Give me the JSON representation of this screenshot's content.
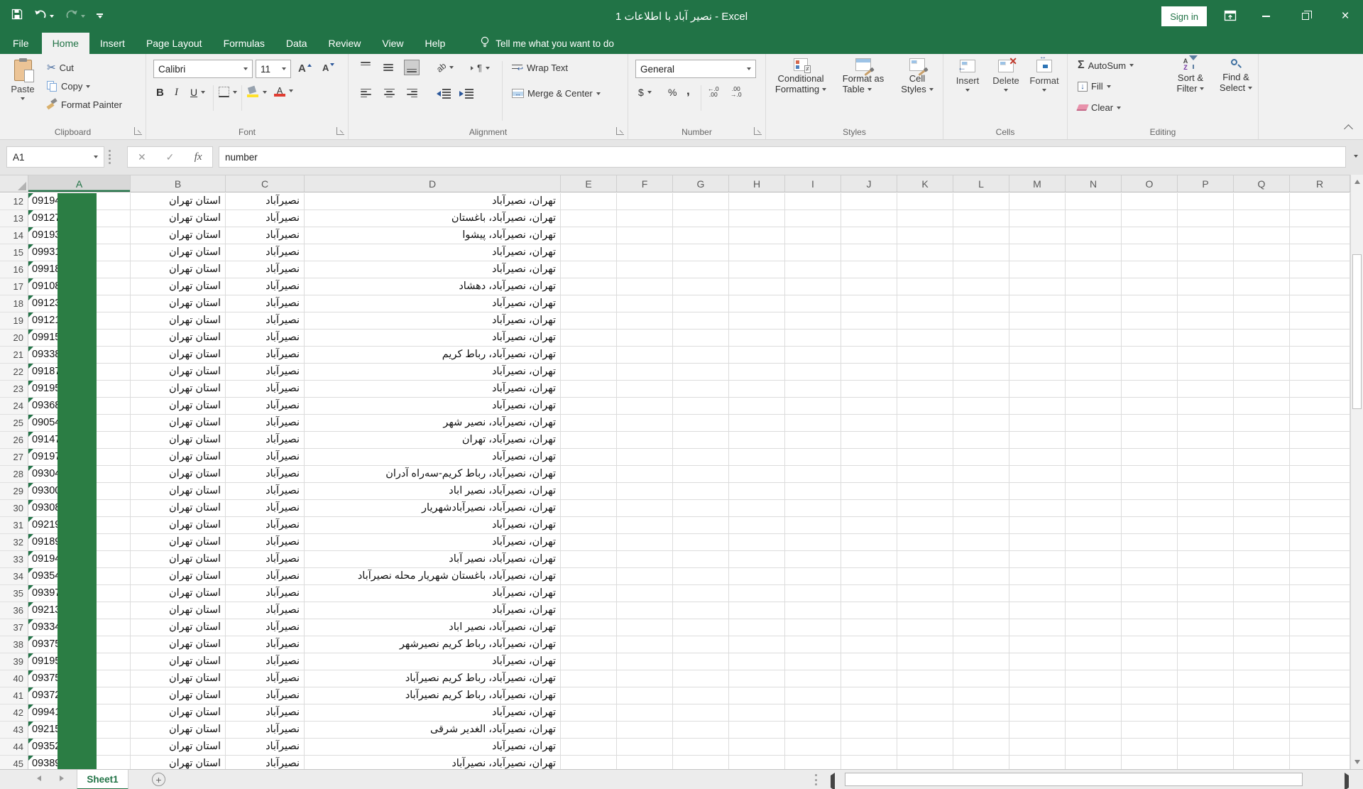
{
  "titlebar": {
    "title": "نصیر آباد با اطلاعات 1 - Excel",
    "sign_in": "Sign in"
  },
  "tabs": {
    "items": [
      "File",
      "Home",
      "Insert",
      "Page Layout",
      "Formulas",
      "Data",
      "Review",
      "View",
      "Help"
    ],
    "active": "Home",
    "tell_me": "Tell me what you want to do"
  },
  "ribbon": {
    "clipboard": {
      "label": "Clipboard",
      "paste": "Paste",
      "cut": "Cut",
      "copy": "Copy",
      "format_painter": "Format Painter"
    },
    "font": {
      "label": "Font",
      "family": "Calibri",
      "size": "11",
      "bold": "B",
      "italic": "I",
      "underline": "U"
    },
    "alignment": {
      "label": "Alignment",
      "wrap_text": "Wrap Text",
      "merge_center": "Merge & Center"
    },
    "number": {
      "label": "Number",
      "format": "General",
      "currency": "$",
      "percent": "%",
      "comma": ","
    },
    "styles": {
      "label": "Styles",
      "conditional_line1": "Conditional",
      "conditional_line2": "Formatting",
      "format_table_line1": "Format as",
      "format_table_line2": "Table",
      "cell_styles_line1": "Cell",
      "cell_styles_line2": "Styles"
    },
    "cells": {
      "label": "Cells",
      "insert": "Insert",
      "delete": "Delete",
      "format": "Format"
    },
    "editing": {
      "label": "Editing",
      "sigma": "Σ",
      "autosum": "AutoSum",
      "fill": "Fill",
      "clear": "Clear",
      "sort_line1": "Sort &",
      "sort_line2": "Filter",
      "find_line1": "Find &",
      "find_line2": "Select"
    }
  },
  "formula_bar": {
    "name_box": "A1",
    "fx": "fx",
    "value": "number"
  },
  "grid": {
    "selected_column": "A",
    "columns": [
      "A",
      "B",
      "C",
      "D",
      "E",
      "F",
      "G",
      "H",
      "I",
      "J",
      "K",
      "L",
      "M",
      "N",
      "O",
      "P",
      "Q",
      "R"
    ],
    "rows": [
      {
        "n": "12",
        "a": "09194",
        "b": "استان تهران",
        "c": "نصیرآباد",
        "d": "تهران، نصیرآباد"
      },
      {
        "n": "13",
        "a": "09127",
        "b": "استان تهران",
        "c": "نصیرآباد",
        "d": "تهران، نصیرآباد، باغستان"
      },
      {
        "n": "14",
        "a": "09193",
        "b": "استان تهران",
        "c": "نصیرآباد",
        "d": "تهران، نصیرآباد، پیشوا"
      },
      {
        "n": "15",
        "a": "09931",
        "b": "استان تهران",
        "c": "نصیرآباد",
        "d": "تهران، نصیرآباد"
      },
      {
        "n": "16",
        "a": "09918",
        "b": "استان تهران",
        "c": "نصیرآباد",
        "d": "تهران، نصیرآباد"
      },
      {
        "n": "17",
        "a": "09108",
        "b": "استان تهران",
        "c": "نصیرآباد",
        "d": "تهران، نصیرآباد، دهشاد"
      },
      {
        "n": "18",
        "a": "09123",
        "b": "استان تهران",
        "c": "نصیرآباد",
        "d": "تهران، نصیرآباد"
      },
      {
        "n": "19",
        "a": "09121",
        "b": "استان تهران",
        "c": "نصیرآباد",
        "d": "تهران، نصیرآباد"
      },
      {
        "n": "20",
        "a": "09915",
        "b": "استان تهران",
        "c": "نصیرآباد",
        "d": "تهران، نصیرآباد"
      },
      {
        "n": "21",
        "a": "09338",
        "b": "استان تهران",
        "c": "نصیرآباد",
        "d": "تهران، نصیرآباد، رباط کریم"
      },
      {
        "n": "22",
        "a": "09187",
        "b": "استان تهران",
        "c": "نصیرآباد",
        "d": "تهران، نصیرآباد"
      },
      {
        "n": "23",
        "a": "09195",
        "b": "استان تهران",
        "c": "نصیرآباد",
        "d": "تهران، نصیرآباد"
      },
      {
        "n": "24",
        "a": "09368",
        "b": "استان تهران",
        "c": "نصیرآباد",
        "d": "تهران، نصیرآباد"
      },
      {
        "n": "25",
        "a": "09054",
        "b": "استان تهران",
        "c": "نصیرآباد",
        "d": "تهران، نصیرآباد، نصیر شهر"
      },
      {
        "n": "26",
        "a": "09147",
        "b": "استان تهران",
        "c": "نصیرآباد",
        "d": "تهران، نصیرآباد، تهران"
      },
      {
        "n": "27",
        "a": "09197",
        "b": "استان تهران",
        "c": "نصیرآباد",
        "d": "تهران، نصیرآباد"
      },
      {
        "n": "28",
        "a": "09304",
        "b": "استان تهران",
        "c": "نصیرآباد",
        "d": "تهران، نصیرآباد، رباط کریم-سه‌راه آدران"
      },
      {
        "n": "29",
        "a": "09300",
        "b": "استان تهران",
        "c": "نصیرآباد",
        "d": "تهران، نصیرآباد، نصیر اباد"
      },
      {
        "n": "30",
        "a": "09308",
        "b": "استان تهران",
        "c": "نصیرآباد",
        "d": "تهران، نصیرآباد، نصیرآبادشهریار"
      },
      {
        "n": "31",
        "a": "09219",
        "b": "استان تهران",
        "c": "نصیرآباد",
        "d": "تهران، نصیرآباد"
      },
      {
        "n": "32",
        "a": "09189",
        "b": "استان تهران",
        "c": "نصیرآباد",
        "d": "تهران، نصیرآباد"
      },
      {
        "n": "33",
        "a": "09194",
        "b": "استان تهران",
        "c": "نصیرآباد",
        "d": "تهران، نصیرآباد، نصیر آباد"
      },
      {
        "n": "34",
        "a": "09354",
        "b": "استان تهران",
        "c": "نصیرآباد",
        "d": "تهران، نصیرآباد، باغستان شهریار محله نصیرآباد"
      },
      {
        "n": "35",
        "a": "09397",
        "b": "استان تهران",
        "c": "نصیرآباد",
        "d": "تهران، نصیرآباد"
      },
      {
        "n": "36",
        "a": "09213",
        "b": "استان تهران",
        "c": "نصیرآباد",
        "d": "تهران، نصیرآباد"
      },
      {
        "n": "37",
        "a": "09334",
        "b": "استان تهران",
        "c": "نصیرآباد",
        "d": "تهران، نصیرآباد، نصیر اباد"
      },
      {
        "n": "38",
        "a": "09375",
        "b": "استان تهران",
        "c": "نصیرآباد",
        "d": "تهران، نصیرآباد، رباط کریم نصیرشهر"
      },
      {
        "n": "39",
        "a": "09195",
        "b": "استان تهران",
        "c": "نصیرآباد",
        "d": "تهران، نصیرآباد"
      },
      {
        "n": "40",
        "a": "09375",
        "b": "استان تهران",
        "c": "نصیرآباد",
        "d": "تهران، نصیرآباد، رباط کریم نصیرآباد"
      },
      {
        "n": "41",
        "a": "09372",
        "b": "استان تهران",
        "c": "نصیرآباد",
        "d": "تهران، نصیرآباد، رباط کریم نصیرآباد"
      },
      {
        "n": "42",
        "a": "09941",
        "b": "استان تهران",
        "c": "نصیرآباد",
        "d": "تهران، نصیرآباد"
      },
      {
        "n": "43",
        "a": "09215",
        "b": "استان تهران",
        "c": "نصیرآباد",
        "d": "تهران، نصیرآباد، الغدیر شرقی"
      },
      {
        "n": "44",
        "a": "09352",
        "b": "استان تهران",
        "c": "نصیرآباد",
        "d": "تهران، نصیرآباد"
      },
      {
        "n": "45",
        "a": "09389",
        "b": "استان تهران",
        "c": "نصیرآباد",
        "d": "تهران، نصیرآباد، نصیرآباد"
      }
    ]
  },
  "sheet_bar": {
    "sheet": "Sheet1"
  },
  "colors": {
    "excel_green": "#217346",
    "fill_green": "#2b7d44"
  }
}
